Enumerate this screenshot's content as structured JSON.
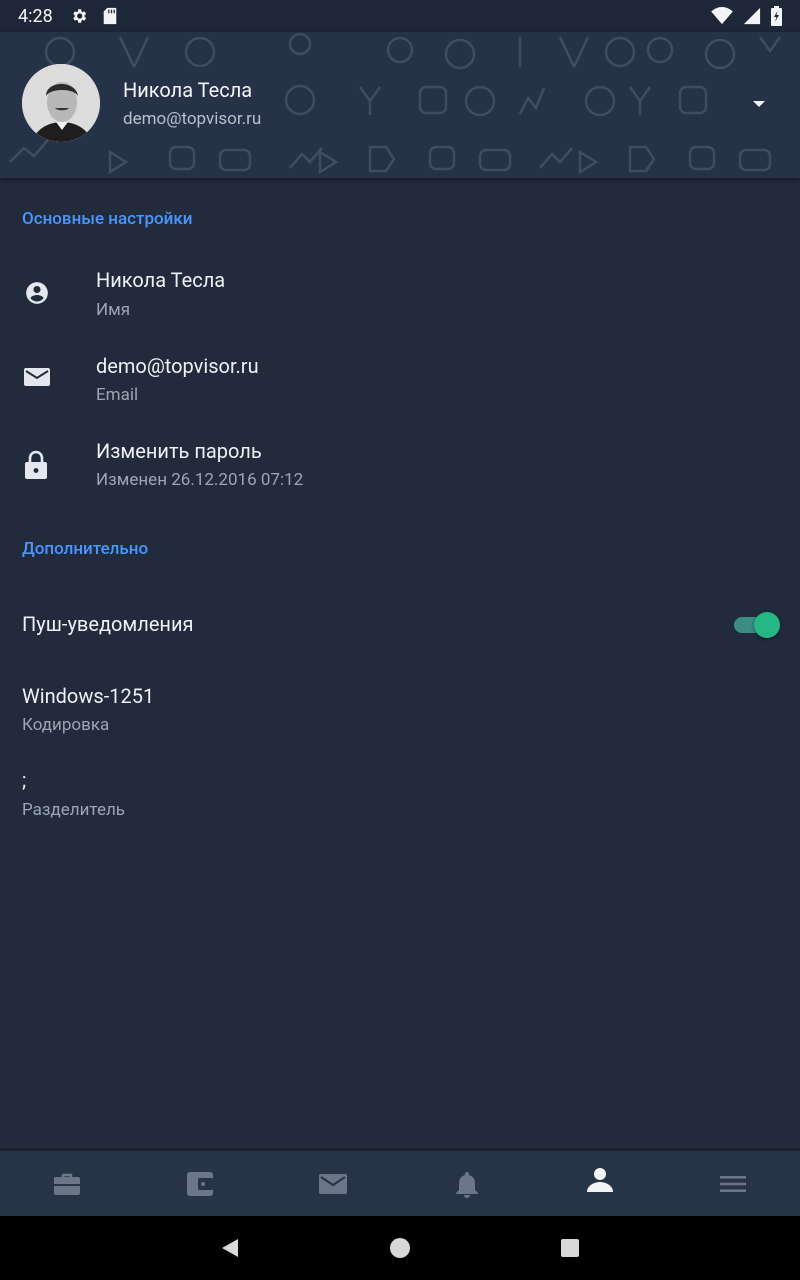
{
  "status_bar": {
    "time": "4:28",
    "icons": [
      "gear-icon",
      "sd-card-icon",
      "wifi-icon",
      "cell-signal-icon",
      "battery-icon"
    ]
  },
  "profile": {
    "name": "Никола Тесла",
    "email": "demo@topvisor.ru"
  },
  "sections": {
    "basic": {
      "title": "Основные настройки",
      "name_value": "Никола Тесла",
      "name_label": "Имя",
      "email_value": "demo@topvisor.ru",
      "email_label": "Email",
      "password_title": "Изменить пароль",
      "password_sub": "Изменен 26.12.2016 07:12"
    },
    "extra": {
      "title": "Дополнительно",
      "push_label": "Пуш-уведомления",
      "push_enabled": true,
      "encoding_value": "Windows-1251",
      "encoding_label": "Кодировка",
      "separator_value": ";",
      "separator_label": "Разделитель"
    }
  },
  "bottom_nav": {
    "items": [
      "briefcase-icon",
      "wallet-icon",
      "mail-icon",
      "bell-icon",
      "person-icon",
      "menu-icon"
    ],
    "active": "person-icon"
  },
  "colors": {
    "background": "#212b3c",
    "accent": "#4a96ff",
    "toggle_on": "#25b886"
  }
}
